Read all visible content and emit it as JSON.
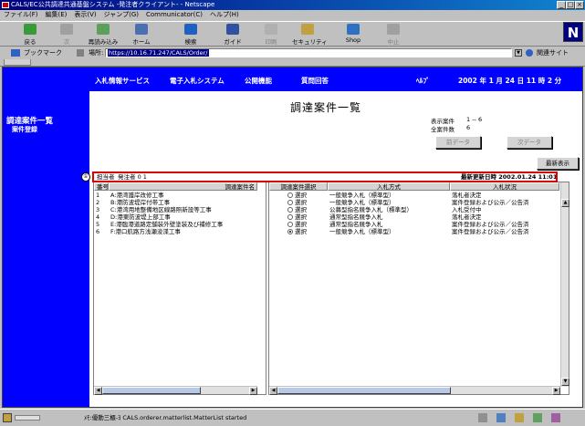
{
  "window": {
    "title": "CALS/EC公共調達共通基盤システム -発注者クライアント- - Netscape"
  },
  "menu": [
    "ファイル(F)",
    "編集(E)",
    "表示(V)",
    "ジャンプ(G)",
    "Communicator(C)",
    "ヘルプ(H)"
  ],
  "toolbar": [
    {
      "label": "戻る",
      "icon": "back-arrow-icon",
      "enabled": true
    },
    {
      "label": "次",
      "icon": "forward-arrow-icon",
      "enabled": false
    },
    {
      "label": "再読み込み",
      "icon": "reload-icon",
      "enabled": true
    },
    {
      "label": "ホーム",
      "icon": "home-icon",
      "enabled": true
    },
    {
      "label": "検索",
      "icon": "search-icon",
      "enabled": true
    },
    {
      "label": "ガイド",
      "icon": "guide-icon",
      "enabled": true
    },
    {
      "label": "印刷",
      "icon": "print-icon",
      "enabled": false
    },
    {
      "label": "セキュリティ",
      "icon": "security-lock-icon",
      "enabled": true
    },
    {
      "label": "Shop",
      "icon": "shop-icon",
      "enabled": true
    },
    {
      "label": "中止",
      "icon": "stop-icon",
      "enabled": false
    }
  ],
  "location": {
    "bookmarks": "ブックマーク",
    "label": "場所:",
    "url": "https://10.16.71.247/CALS/Order/",
    "related": "関連サイト"
  },
  "sidebar": {
    "title": "調達案件一覧",
    "subtitle": "案件登録"
  },
  "topnav": {
    "items": [
      "入札情報サービス",
      "電子入札システム",
      "公開機能",
      "質問回答"
    ],
    "help": "ﾍﾙﾌﾟ",
    "date": "2002 年  1 月 24 日   11 時  2 分"
  },
  "page": {
    "title": "調達案件一覧",
    "display_label": "表示案件",
    "display_value": "1 -- 6",
    "total_label": "全案件数",
    "total_value": "6",
    "prev_button": "前データ",
    "next_button": "次データ",
    "refresh_button": "最新表示",
    "owner_label": "担当者",
    "owner_value": "発注者 0 1",
    "updated": "最新更新日時 2002.01.24 11:01"
  },
  "table": {
    "left_headers": [
      "番号",
      "調達案件名"
    ],
    "right_headers": [
      "調達案件選択",
      "入札方式",
      "入札状況"
    ],
    "rows": [
      {
        "no": "1",
        "name": "A:港湾護岸改修工事",
        "select": "選択",
        "method": "一般競争入札（標準型）",
        "status": "落札者決定",
        "selected": false
      },
      {
        "no": "2",
        "name": "B:港防波堤岸付帯工事",
        "select": "選択",
        "method": "一般競争入札（標準型）",
        "status": "案件登録および公示／公告済",
        "selected": false
      },
      {
        "no": "3",
        "name": "C:港湾用地整備地区線路照新設等工事",
        "select": "選択",
        "method": "公募型指名競争入札（標準型）",
        "status": "入札受付中",
        "selected": false
      },
      {
        "no": "4",
        "name": "D:港東防波堤上部工事",
        "select": "選択",
        "method": "通常型指名競争入札",
        "status": "落札者決定",
        "selected": false
      },
      {
        "no": "5",
        "name": "E:港臨港道路定舗装外壁塗装及び補修工事",
        "select": "選択",
        "method": "通常型指名競争入札",
        "status": "案件登録および公示／公告済",
        "selected": false
      },
      {
        "no": "6",
        "name": "F:港口航路方浅瀬浚渫工事",
        "select": "選択",
        "method": "一般競争入札（標準型）",
        "status": "案件登録および公示／公告済",
        "selected": true
      }
    ]
  },
  "annotation": {
    "marker": "①"
  },
  "status": {
    "text": "ﾒﾓ:優動三櫃-ﾖ CALS.orderer.matterlist.MatterList started"
  },
  "colors": {
    "sidebar": "#0000ff",
    "highlight": "#e00000",
    "titlebar": "#000080"
  }
}
